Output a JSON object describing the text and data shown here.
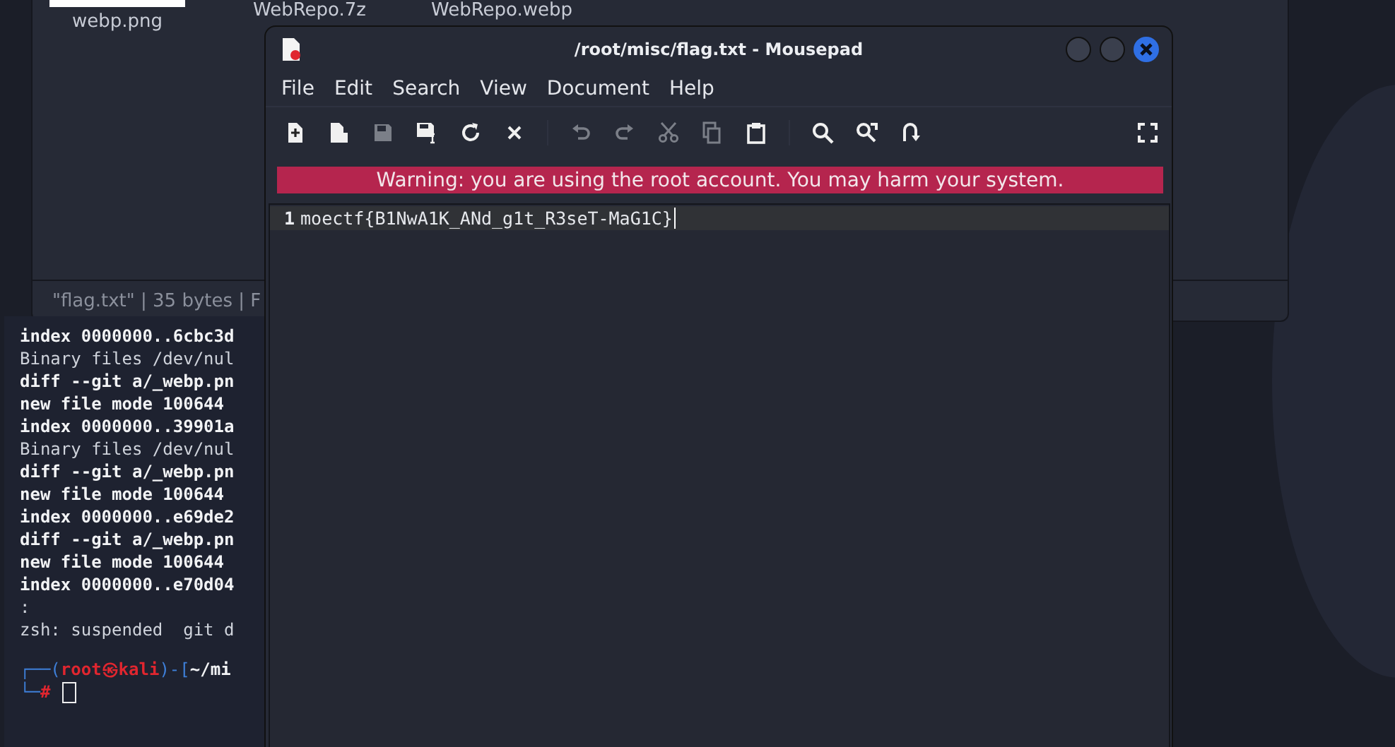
{
  "file_manager": {
    "files": [
      {
        "name": "webp.png",
        "thumbnail": true
      },
      {
        "name": "WebRepo.7z",
        "thumbnail": false
      },
      {
        "name": "WebRepo.webp",
        "thumbnail": false
      }
    ],
    "status_bar": "\"flag.txt\" | 35 bytes | F"
  },
  "terminal": {
    "lines": [
      {
        "text": "index 0000000..6cbc3d",
        "bold": true
      },
      {
        "text": "Binary files /dev/nul",
        "bold": false
      },
      {
        "text": "diff --git a/_webp.pn",
        "bold": true
      },
      {
        "text": "new file mode 100644",
        "bold": true
      },
      {
        "text": "index 0000000..39901a",
        "bold": true
      },
      {
        "text": "Binary files /dev/nul",
        "bold": false
      },
      {
        "text": "diff --git a/_webp.pn",
        "bold": true
      },
      {
        "text": "new file mode 100644",
        "bold": true
      },
      {
        "text": "index 0000000..e69de2",
        "bold": true
      },
      {
        "text": "diff --git a/_webp.pn",
        "bold": true
      },
      {
        "text": "new file mode 100644",
        "bold": true
      },
      {
        "text": "index 0000000..e70d04",
        "bold": true
      },
      {
        "text": ":",
        "bold": false
      },
      {
        "text": "zsh: suspended  git d",
        "bold": false
      }
    ],
    "prompt": {
      "frame_top": "┌──(",
      "user": "root㉿kali",
      "bracket": ")-[",
      "path": "~/mi",
      "frame_bottom": "└─",
      "symbol": "#"
    }
  },
  "editor": {
    "title": "/root/misc/flag.txt - Mousepad",
    "menu": [
      "File",
      "Edit",
      "Search",
      "View",
      "Document",
      "Help"
    ],
    "toolbar": [
      [
        {
          "kind": "new",
          "disabled": false
        },
        {
          "kind": "open",
          "disabled": false
        },
        {
          "kind": "save",
          "disabled": true
        },
        {
          "kind": "save-as",
          "disabled": false
        },
        {
          "kind": "reload",
          "disabled": false
        },
        {
          "kind": "close",
          "disabled": false
        }
      ],
      [
        {
          "kind": "undo",
          "disabled": true
        },
        {
          "kind": "redo",
          "disabled": true
        },
        {
          "kind": "cut",
          "disabled": true
        },
        {
          "kind": "copy",
          "disabled": true
        },
        {
          "kind": "paste",
          "disabled": false
        }
      ],
      [
        {
          "kind": "find",
          "disabled": false
        },
        {
          "kind": "replace",
          "disabled": false
        },
        {
          "kind": "goto",
          "disabled": false
        }
      ]
    ],
    "warning": "Warning: you are using the root account. You may harm your system.",
    "lines": [
      {
        "number": "1",
        "text": "moectf{B1NwA1K_ANd_g1t_R3seT-MaG1C}"
      }
    ]
  }
}
